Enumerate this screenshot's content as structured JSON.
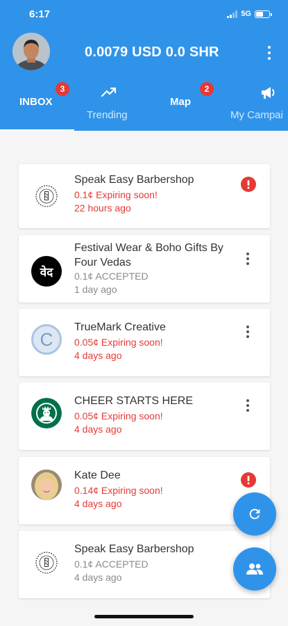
{
  "status_bar": {
    "time": "6:17",
    "network": "5G"
  },
  "header": {
    "balance": "0.0079 USD 0.0 SHR",
    "avatar_icon": "user-avatar",
    "menu_icon": "more-vertical-icon"
  },
  "tabs": [
    {
      "label": "INBOX",
      "badge": "3",
      "active": true
    },
    {
      "label": "Trending",
      "icon": "trending-up-icon"
    },
    {
      "label": "Map",
      "badge": "2"
    },
    {
      "label": "My Campai",
      "icon": "megaphone-icon"
    }
  ],
  "inbox": [
    {
      "name": "Speak Easy Barbershop",
      "status": "0.1¢ Expiring soon!",
      "time": "22 hours ago",
      "expiring": true,
      "action": "alert"
    },
    {
      "name": "Festival Wear & Boho Gifts By Four Vedas",
      "status": "0.1¢ ACCEPTED",
      "time": "1 day ago",
      "expiring": false,
      "action": "menu",
      "logo_text": "वेद"
    },
    {
      "name": "TrueMark Creative",
      "status": "0.05¢ Expiring soon!",
      "time": "4 days ago",
      "expiring": true,
      "action": "menu",
      "logo_text": "C"
    },
    {
      "name": "CHEER STARTS HERE",
      "status": "0.05¢ Expiring soon!",
      "time": "4 days ago",
      "expiring": true,
      "action": "menu"
    },
    {
      "name": "Kate Dee",
      "status": "0.14¢ Expiring soon!",
      "time": "4 days ago",
      "expiring": true,
      "action": "alert"
    },
    {
      "name": "Speak Easy Barbershop",
      "status": "0.1¢ ACCEPTED",
      "time": "4 days ago",
      "expiring": false,
      "action": "none"
    }
  ],
  "fabs": [
    {
      "icon": "refresh-icon"
    },
    {
      "icon": "people-icon"
    }
  ],
  "colors": {
    "primary": "#2f93ea",
    "expiring_text": "#e53935",
    "neutral_text": "#8a8a8a",
    "badge": "#e53935",
    "background": "#f5f5f5"
  }
}
